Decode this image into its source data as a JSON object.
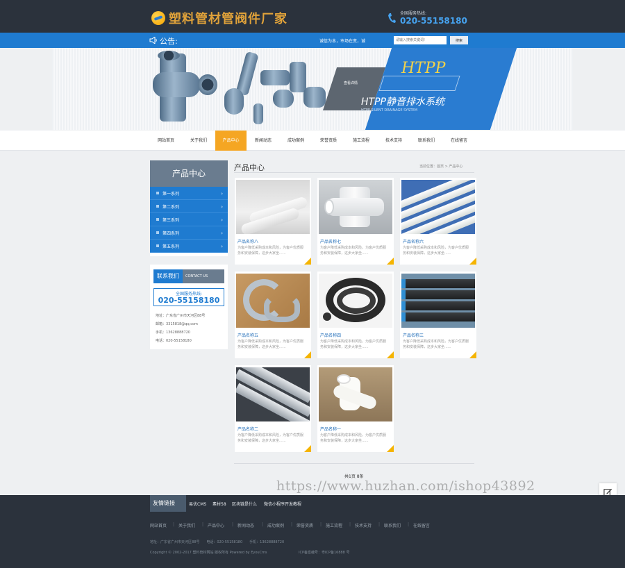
{
  "header": {
    "logo_text": "塑料管材管阀件厂家",
    "hotline_label": "全国服务热线:",
    "hotline_number": "020-55158180"
  },
  "notice": {
    "label": "公告:",
    "text": "诚信为本，市场在变，诚",
    "search_placeholder": "请输入搜索关键词!",
    "search_button": "搜索"
  },
  "banner": {
    "tag": "查看详情",
    "brand": "HTPP",
    "title": "HTPP静音排水系统",
    "subtitle": "HTPP SILENT DRAINAGE SYSTEM"
  },
  "nav": {
    "items": [
      "网站首页",
      "关于我们",
      "产品中心",
      "新闻动态",
      "成功案例",
      "荣誉资质",
      "施工流程",
      "技术支持",
      "联系我们",
      "在线留言"
    ],
    "active_index": 2
  },
  "sidebar": {
    "title": "产品中心",
    "items": [
      "第一系列",
      "第二系列",
      "第三系列",
      "第四系列",
      "第五系列"
    ]
  },
  "contact": {
    "title_cn": "联系我们",
    "title_en": "CONTACT US",
    "hotline_label": "全国服务热线:",
    "hotline_number": "020-55158180",
    "lines": [
      "地址：广东省广州市天河区88号",
      "邮箱：3315818@qq.com",
      "手机：13628888720",
      "电话：020-55158180"
    ]
  },
  "main": {
    "title": "产品中心",
    "breadcrumb": "当前位置：首页 > 产品中心",
    "pager": "共1页 8条"
  },
  "products": [
    {
      "name": "产品名称八",
      "desc": "为客户降低采购成本和风险，为客户优质服务和安装保障，这步大家坐......"
    },
    {
      "name": "产品名称七",
      "desc": "为客户降低采购成本和风险，为客户优质服务和安装保障，这步大家坐......"
    },
    {
      "name": "产品名称六",
      "desc": "为客户降低采购成本和风险，为客户优质服务和安装保障，这步大家坐......"
    },
    {
      "name": "产品名称五",
      "desc": "为客户降低采购成本和风险，为客户优质服务和安装保障，这步大家坐......"
    },
    {
      "name": "产品名称四",
      "desc": "为客户降低采购成本和风险，为客户优质服务和安装保障，这步大家坐......"
    },
    {
      "name": "产品名称三",
      "desc": "为客户降低采购成本和风险，为客户优质服务和安装保障，这步大家坐......"
    },
    {
      "name": "产品名称二",
      "desc": "为客户降低采购成本和风险，为客户优质服务和安装保障，这步大家坐......"
    },
    {
      "name": "产品名称一",
      "desc": "为客户降低采购成本和风险，为客户优质服务和安装保障，这步大家坐......"
    }
  ],
  "watermark": "https://www.huzhan.com/ishop43892",
  "friend_links": {
    "label": "友情链接",
    "items": [
      "易优CMS",
      "素材58",
      "区块链是什么",
      "微信小程序开发教程"
    ]
  },
  "footer": {
    "nav": [
      "网站首页",
      "关于我们",
      "产品中心",
      "新闻动态",
      "成功案例",
      "荣誉资质",
      "施工流程",
      "技术支持",
      "联系我们",
      "在线留言"
    ],
    "contact_line": "地址：广东省广州市天河区88号　　电话：020-55158180　　手机：13628888720",
    "copyright": "Copyright © 2002-2017 塑料管材网站 版权所有 Powered by EyouCms",
    "icp": "ICP备案编号：粤ICP备16888 号"
  }
}
